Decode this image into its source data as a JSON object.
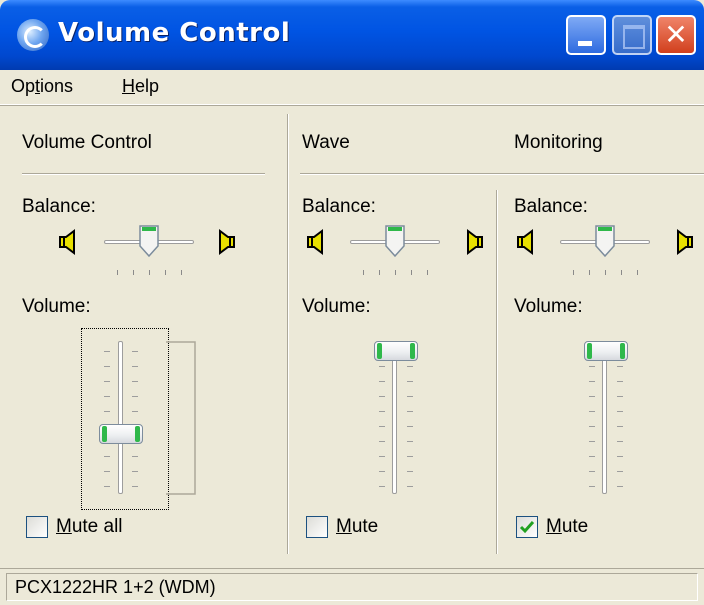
{
  "window": {
    "title": "Volume Control",
    "icon": "volume-app-icon"
  },
  "title_buttons": [
    "minimize",
    "maximize",
    "close"
  ],
  "menu": {
    "options": {
      "label": "Options",
      "prefix": "Op",
      "accel": "t",
      "suffix": "ions"
    },
    "help": {
      "label": "Help",
      "prefix": "",
      "accel": "H",
      "suffix": "elp"
    }
  },
  "channels": [
    {
      "name": "Volume Control",
      "balance_label": "Balance:",
      "balance": 0.5,
      "volume_label": "Volume:",
      "volume": 0.43,
      "mute_label": "Mute all",
      "mute_accel": "M",
      "mute_rest": "ute all",
      "muted": false
    },
    {
      "name": "Wave",
      "balance_label": "Balance:",
      "balance": 0.5,
      "volume_label": "Volume:",
      "volume": 1.0,
      "mute_label": "Mute",
      "mute_accel": "M",
      "mute_rest": "ute",
      "muted": false
    },
    {
      "name": "Monitoring",
      "balance_label": "Balance:",
      "balance": 0.5,
      "volume_label": "Volume:",
      "volume": 1.0,
      "mute_label": "Mute",
      "mute_accel": "M",
      "mute_rest": "ute",
      "muted": true
    }
  ],
  "status": {
    "device": "PCX1222HR 1+2 (WDM)"
  },
  "colors": {
    "titlebar": "#0054E3",
    "window_bg": "#ECE9D8",
    "thumb_accent": "#2FB84A",
    "check": "#21A121"
  }
}
